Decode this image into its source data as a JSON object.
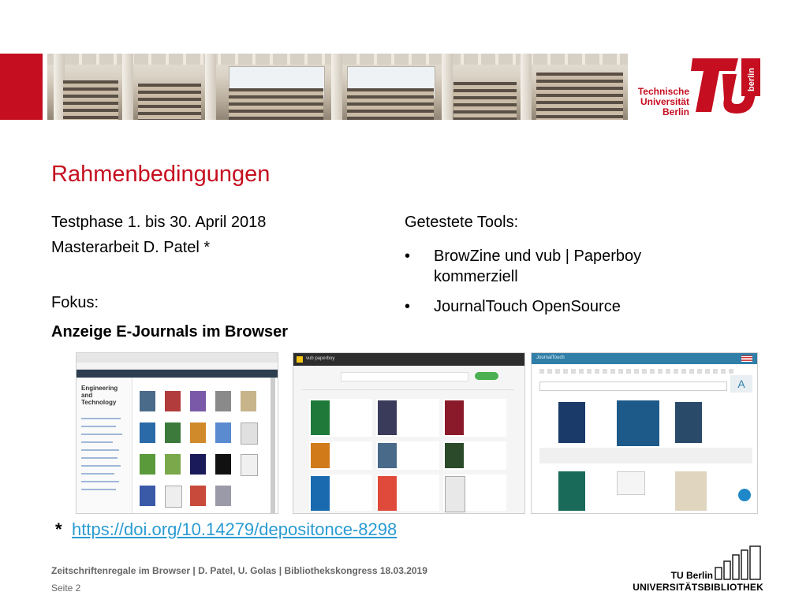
{
  "header": {
    "logo_text": [
      "Technische",
      "Universität",
      "Berlin"
    ],
    "logo_side_text": "berlin",
    "brand_color": "#c50e1f"
  },
  "slide": {
    "title": "Rahmenbedingungen",
    "left": {
      "line1": "Testphase 1. bis 30. April 2018",
      "line2": "Masterarbeit D. Patel *",
      "focus_label": "Fokus:",
      "focus_value": "Anzeige E-Journals im Browser"
    },
    "tools": {
      "heading": "Getestete Tools:",
      "items": [
        {
          "bullet": "•",
          "text": "BrowZine und vub | Paperboy kommerziell"
        },
        {
          "bullet": "•",
          "text": "JournalTouch OpenSource"
        }
      ]
    },
    "screenshots": [
      {
        "heading": "Engineering and Technology"
      },
      {
        "heading": "vub paperboy"
      },
      {
        "heading": "JournalTouch"
      }
    ],
    "doi": {
      "star": "*",
      "link": "https://doi.org/10.14279/depositonce-8298"
    }
  },
  "footer": {
    "line": "Zeitschriftenregale im Browser | D. Patel, U. Golas | Bibliothekskongress 18.03.2019",
    "page": "Seite 2",
    "ub_line1": "TU Berlin",
    "ub_line2": "UNIVERSITÄTSBIBLIOTHEK"
  }
}
